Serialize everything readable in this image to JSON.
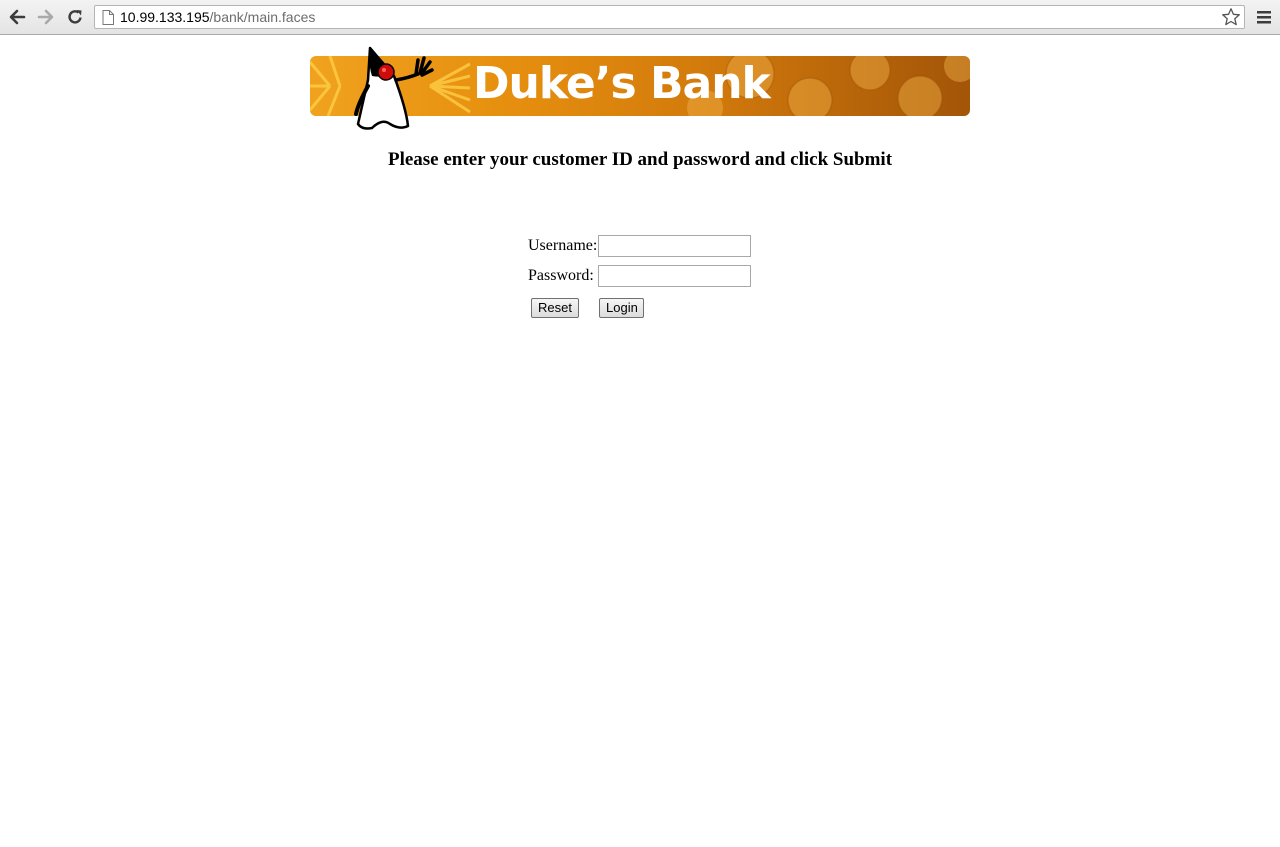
{
  "browser": {
    "url_host": "10.99.133.195",
    "url_path": "/bank/main.faces",
    "icons": {
      "back": "back-arrow-icon",
      "forward": "forward-arrow-icon",
      "reload": "reload-icon",
      "page": "page-icon",
      "bookmark": "star-icon",
      "menu": "menu-icon"
    }
  },
  "banner": {
    "title": "Duke’s Bank",
    "colors": {
      "start": "#f0a21e",
      "end": "#a35508",
      "text": "#ffffff"
    }
  },
  "login": {
    "instructions": "Please enter your customer ID and password and click Submit",
    "username_label": "Username:",
    "password_label": "Password:",
    "username_value": "",
    "password_value": "",
    "reset_label": "Reset",
    "login_label": "Login"
  }
}
